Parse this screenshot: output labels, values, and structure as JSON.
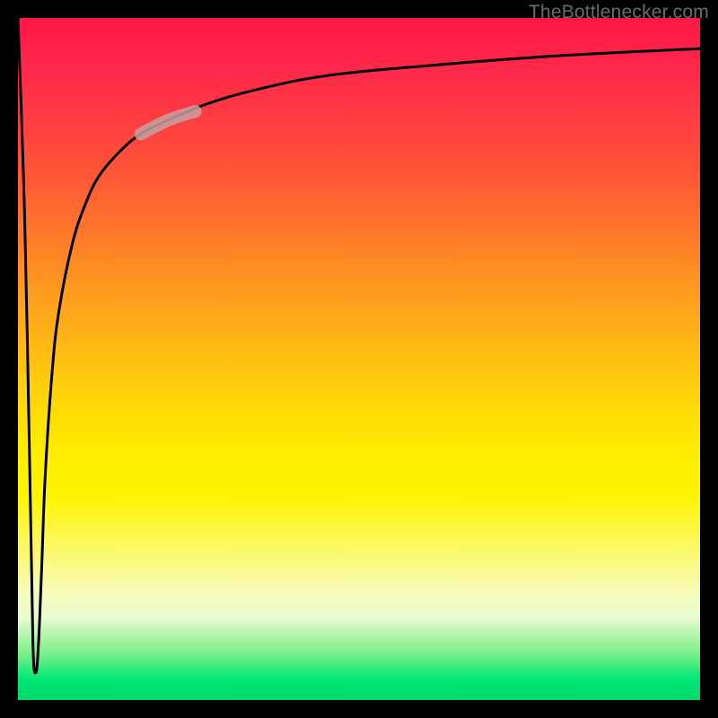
{
  "attribution": "TheBottlenecker.com",
  "chart_data": {
    "type": "line",
    "title": "",
    "xlabel": "",
    "ylabel": "",
    "xlim": [
      0,
      100
    ],
    "ylim": [
      0,
      100
    ],
    "annotations": [],
    "series": [
      {
        "name": "curve",
        "x": [
          0,
          1,
          1.8,
          2.2,
          2.6,
          3.0,
          3.5,
          4.0,
          5.0,
          6.0,
          8.0,
          10.0,
          12.0,
          15.0,
          18.0,
          22.0,
          28.0,
          35.0,
          45.0,
          60.0,
          80.0,
          100.0
        ],
        "y": [
          100,
          70,
          30,
          8,
          4,
          8,
          20,
          33,
          48,
          57,
          67,
          73,
          77,
          80.5,
          83,
          85,
          87.5,
          89.5,
          91.5,
          93,
          94.5,
          95.5
        ]
      },
      {
        "name": "highlight-segment",
        "x": [
          18.0,
          22.0,
          26.0
        ],
        "y": [
          83,
          85,
          86.3
        ]
      }
    ],
    "colors": {
      "curve": "#000000",
      "highlight": "rgba(200,160,160,0.85)"
    },
    "background": "rainbow-gradient (red top → green bottom)"
  }
}
